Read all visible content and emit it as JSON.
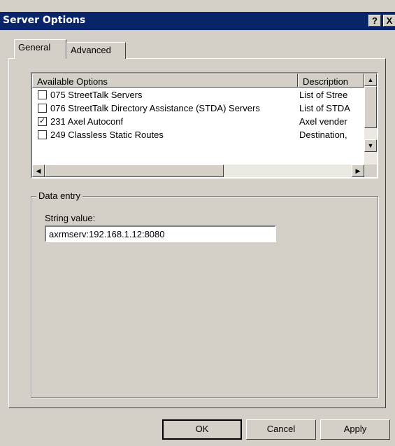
{
  "window": {
    "title": "Server Options",
    "help_label": "?",
    "close_label": "X"
  },
  "tabs": [
    {
      "label": "General",
      "selected": true
    },
    {
      "label": "Advanced",
      "selected": false
    }
  ],
  "options_list": {
    "columns": [
      "Available Options",
      "Description"
    ],
    "rows": [
      {
        "name": "075 StreetTalk Servers",
        "description": "List of Stree",
        "checked": false
      },
      {
        "name": "076 StreetTalk Directory Assistance (STDA) Servers",
        "description": "List of STDA",
        "checked": false
      },
      {
        "name": "231 Axel Autoconf",
        "description": "Axel vender",
        "checked": true
      },
      {
        "name": "249 Classless Static Routes",
        "description": "Destination,",
        "checked": false
      }
    ]
  },
  "data_entry": {
    "group_label": "Data entry",
    "field_label": "String value:",
    "field_value": "axrmserv:192.168.1.12:8080"
  },
  "buttons": {
    "ok": "OK",
    "cancel": "Cancel",
    "apply": "Apply"
  }
}
